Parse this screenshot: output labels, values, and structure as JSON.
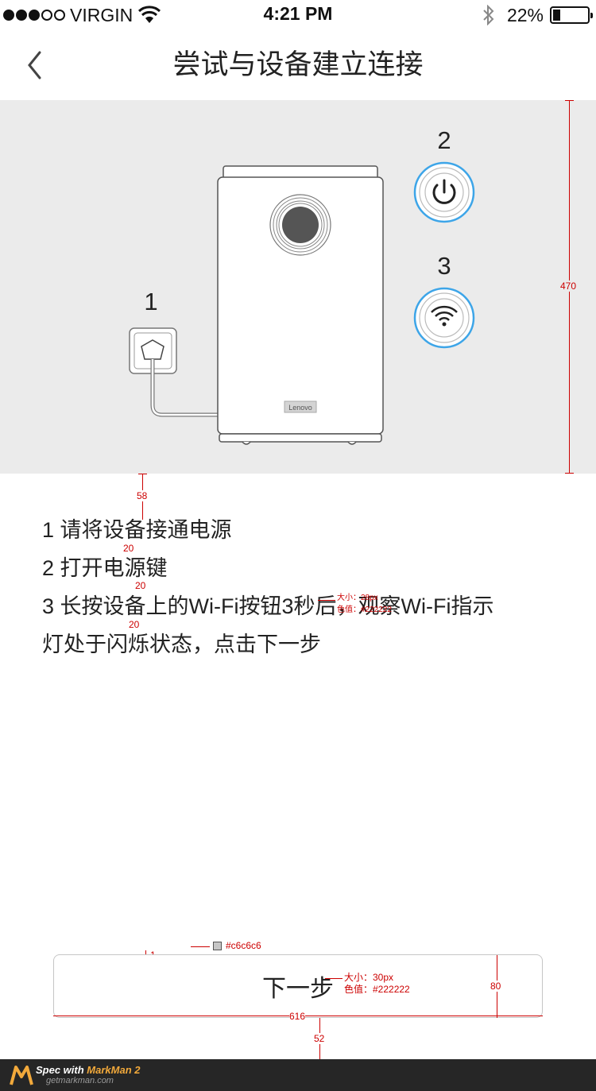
{
  "status_bar": {
    "carrier": "VIRGIN",
    "time": "4:21 PM",
    "battery": "22%",
    "battery_level": 0.22,
    "signal_dots_filled": 3,
    "signal_dots_total": 5,
    "icons": [
      "wifi-icon",
      "bluetooth-icon",
      "battery-icon"
    ]
  },
  "nav": {
    "back_icon": "chevron-left-icon",
    "title": "尝试与设备建立连接"
  },
  "illustration": {
    "step_1": "1",
    "step_2": "2",
    "step_3": "3",
    "brand": "Lenovo",
    "icons": [
      "power-outlet-icon",
      "power-button-icon",
      "wifi-button-icon"
    ],
    "accent_color": "#3da5e8",
    "background_color": "#ebebeb"
  },
  "instructions": {
    "line_1": "1 请将设备接通电源",
    "line_2": "2 打开电源键",
    "line_3": "3 长按设备上的Wi-Fi按钮3秒后，观察Wi-Fi指示",
    "line_4": "灯处于闪烁状态，点击下一步"
  },
  "next_button": {
    "label": "下一步",
    "border_color": "#c6c6c6"
  },
  "spec": {
    "illustration_height": "470",
    "gap_top": "58",
    "line_gap_1": "20",
    "line_gap_2": "20",
    "line_gap_3": "20",
    "text_size": "大小：28px",
    "text_color": "色值：#222222",
    "border_width": "1",
    "border_color_label": "#c6c6c6",
    "button_text_size": "大小：30px",
    "button_text_color": "色值：#222222",
    "button_height": "80",
    "button_width": "616",
    "gap_bottom": "52"
  },
  "footer": {
    "title_prefix": "Spec with ",
    "title_brand": "MarkMan 2",
    "subtitle": "getmarkman.com"
  }
}
